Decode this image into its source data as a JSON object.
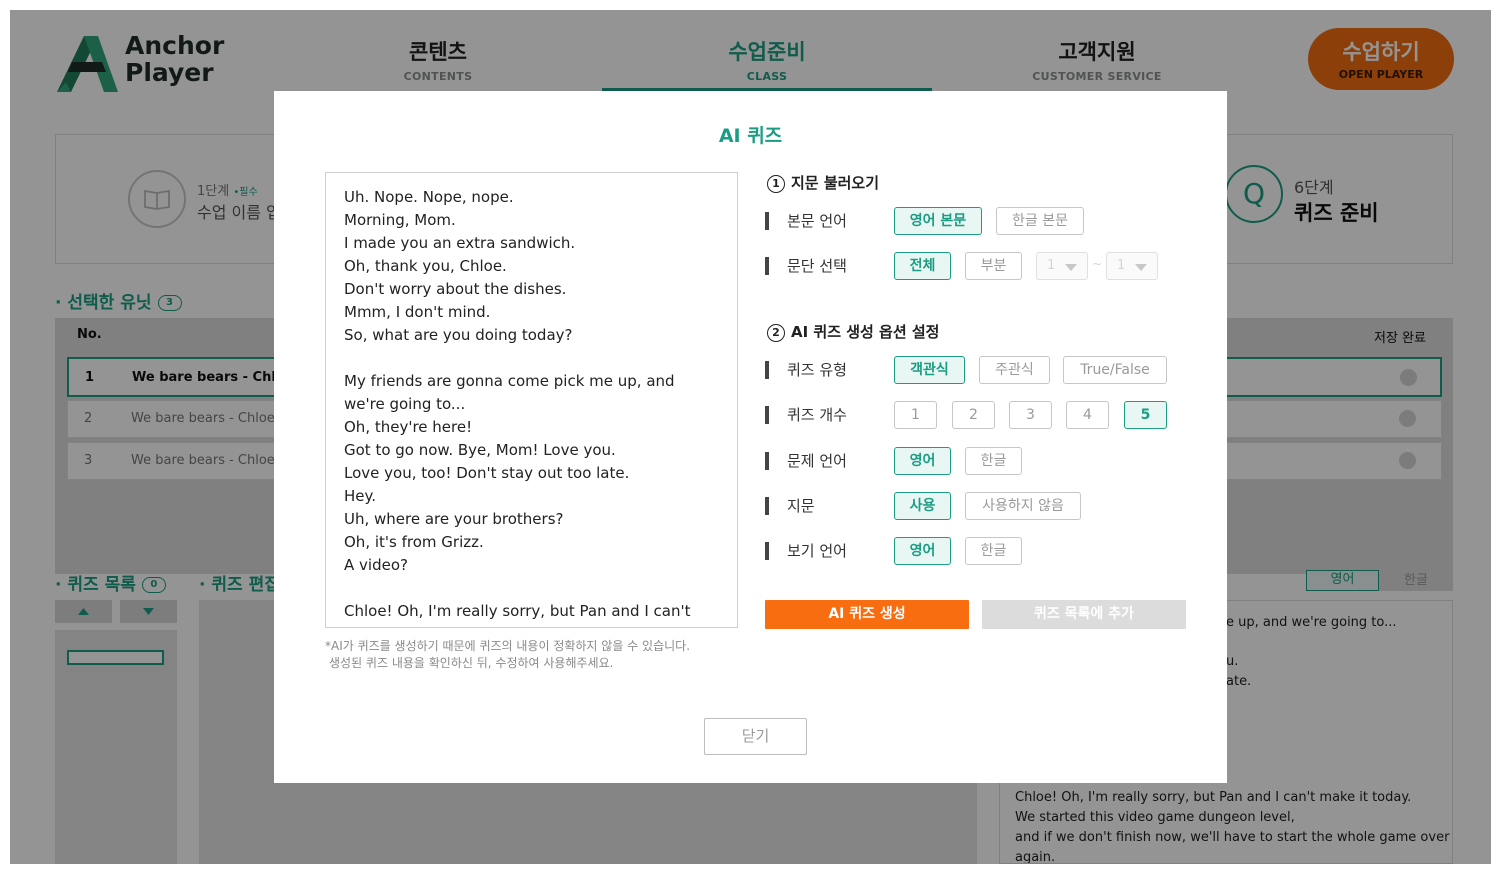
{
  "header": {
    "logo_line1": "Anchor",
    "logo_line2": "Player",
    "nav": [
      {
        "ko": "콘텐츠",
        "en": "CONTENTS"
      },
      {
        "ko": "수업준비",
        "en": "CLASS"
      },
      {
        "ko": "고객지원",
        "en": "CUSTOMER SERVICE"
      }
    ],
    "open_player": {
      "ko": "수업하기",
      "en": "OPEN PLAYER"
    }
  },
  "steps": {
    "step1": {
      "label": "1단계",
      "required": "•필수",
      "title": "수업 이름 입"
    },
    "step6": {
      "label": "6단계",
      "title": "퀴즈 준비",
      "icon": "Q"
    }
  },
  "units": {
    "title": "· 선택한 유닛",
    "count": "3",
    "col_no": "No.",
    "col_saved": "저장 완료",
    "rows": [
      {
        "no": "1",
        "name": "We bare bears - Chloe"
      },
      {
        "no": "2",
        "name": "We bare bears - Chloe"
      },
      {
        "no": "3",
        "name": "We bare bears - Chloe"
      }
    ]
  },
  "quiz_list": {
    "title": "· 퀴즈 목록",
    "count": "0"
  },
  "quiz_edit": {
    "title": "· 퀴즈 편집"
  },
  "lang_toggle": {
    "en": "영어",
    "ko": "한글"
  },
  "bg_script": {
    "l1": "e up, and we're going to...",
    "l2": "u.",
    "l3": "ate.",
    "l4": "Chloe! Oh, I'm really sorry, but Pan and I can't make it today.",
    "l5": "We started this video game dungeon level,",
    "l6": "and if we don't finish now, we'll have to start the whole game over",
    "l7": "again."
  },
  "modal": {
    "title": "AI 퀴즈",
    "script_lines": [
      "Uh. Nope. Nope, nope.",
      "Morning, Mom.",
      "I made you an extra sandwich.",
      "Oh, thank you, Chloe.",
      "Don't worry about the dishes.",
      "Mmm, I don't mind.",
      "So, what are you doing today?",
      "",
      "My friends are gonna come pick me up, and we're going to...",
      "Oh, they're here!",
      "Got to go now. Bye, Mom! Love you.",
      "Love you, too! Don't stay out too late.",
      "Hey.",
      "Uh, where are your brothers?",
      "Oh, it's from Grizz.",
      "A video?",
      "",
      "Chloe! Oh, I'm really sorry, but Pan and I can't"
    ],
    "notice_line1": "*AI가 퀴즈를 생성하기 때문에 퀴즈의 내용이 정확하지 않을 수 있습니다.",
    "notice_line2": "생성된 퀴즈 내용을 확인하신 뒤, 수정하여 사용해주세요.",
    "section1": {
      "num": "1",
      "title": "지문 불러오기"
    },
    "section2": {
      "num": "2",
      "title": "AI 퀴즈 생성 옵션 설정"
    },
    "options": {
      "text_lang": {
        "label": "본문 언어",
        "choices": [
          "영어 본문",
          "한글 본문"
        ],
        "selected": "영어 본문"
      },
      "paragraph": {
        "label": "문단 선택",
        "choices": [
          "전체",
          "부분"
        ],
        "selected": "전체",
        "from": "1",
        "tilde": "~",
        "to": "1"
      },
      "quiz_type": {
        "label": "퀴즈 유형",
        "choices": [
          "객관식",
          "주관식",
          "True/False"
        ],
        "selected": "객관식"
      },
      "quiz_count": {
        "label": "퀴즈 개수",
        "choices": [
          "1",
          "2",
          "3",
          "4",
          "5"
        ],
        "selected": "5"
      },
      "question_lang": {
        "label": "문제 언어",
        "choices": [
          "영어",
          "한글"
        ],
        "selected": "영어"
      },
      "passage": {
        "label": "지문",
        "choices": [
          "사용",
          "사용하지 않음"
        ],
        "selected": "사용"
      },
      "choice_lang": {
        "label": "보기 언어",
        "choices": [
          "영어",
          "한글"
        ],
        "selected": "영어"
      }
    },
    "generate_label": "AI 퀴즈 생성",
    "add_label": "퀴즈 목록에 추가",
    "close_label": "닫기"
  },
  "colors": {
    "accent": "#1b9d83",
    "orange": "#f76d0f"
  }
}
